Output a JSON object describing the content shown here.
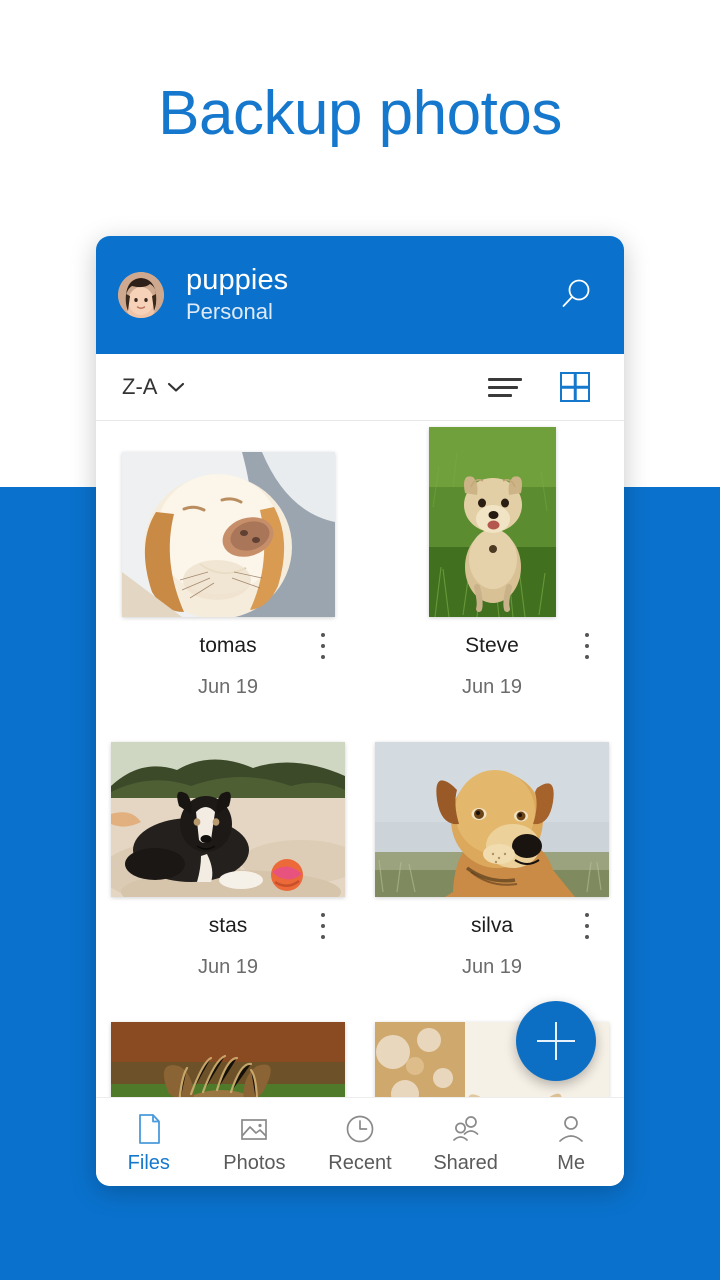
{
  "page": {
    "headline": "Backup photos",
    "accent_blue": "#0a72cd",
    "headline_blue": "#1578cd",
    "background_top": "#ffffff",
    "background_bottom": "#0a72cd"
  },
  "app_header": {
    "title": "puppies",
    "subtitle": "Personal",
    "avatar_icon": "user-avatar-photo",
    "search_icon": "search-icon"
  },
  "toolbar": {
    "sort_label": "Z-A",
    "sort_chevron_icon": "chevron-down-icon",
    "list_view_icon": "list-view-icon",
    "grid_view_icon": "grid-view-icon",
    "active_view": "grid"
  },
  "files": [
    {
      "name": "tomas",
      "date": "Jun 19",
      "thumb": "golden-retriever-closeup",
      "orientation": "landscape",
      "menu_icon": "more-vertical-icon"
    },
    {
      "name": "Steve",
      "date": "Jun 19",
      "thumb": "terrier-in-grass",
      "orientation": "portrait",
      "menu_icon": "more-vertical-icon"
    },
    {
      "name": "stas",
      "date": "Jun 19",
      "thumb": "black-white-puppy-on-sand",
      "orientation": "landscape",
      "menu_icon": "more-vertical-icon"
    },
    {
      "name": "silva",
      "date": "Jun 19",
      "thumb": "tan-dog-portrait",
      "orientation": "landscape",
      "menu_icon": "more-vertical-icon"
    },
    {
      "name": "",
      "date": "",
      "thumb": "yorkshire-terrier-in-grass",
      "orientation": "landscape",
      "menu_icon": "more-vertical-icon"
    },
    {
      "name": "",
      "date": "",
      "thumb": "cream-dog-bokeh",
      "orientation": "landscape",
      "menu_icon": "more-vertical-icon"
    }
  ],
  "fab": {
    "label": "+",
    "icon": "plus-icon",
    "color": "#0d6fc4"
  },
  "bottom_nav": {
    "active": "Files",
    "items": [
      {
        "label": "Files",
        "icon": "document-icon"
      },
      {
        "label": "Photos",
        "icon": "image-icon"
      },
      {
        "label": "Recent",
        "icon": "clock-icon"
      },
      {
        "label": "Shared",
        "icon": "people-icon"
      },
      {
        "label": "Me",
        "icon": "person-icon"
      }
    ]
  }
}
